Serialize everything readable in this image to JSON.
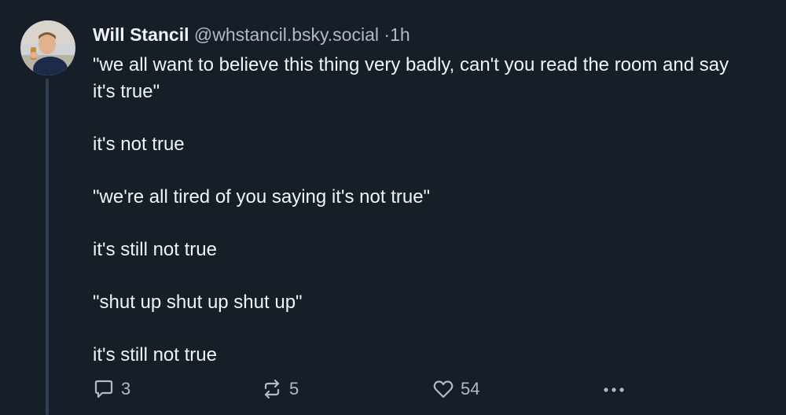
{
  "post": {
    "author": {
      "display_name": "Will Stancil",
      "handle": "@whstancil.bsky.social",
      "separator": "·",
      "timestamp": "1h"
    },
    "body": [
      "\"we all want to believe this thing very badly, can't you read the room and say it's true\"",
      "it's not true",
      "\"we're all tired of you saying it's not true\"",
      "it's still not true",
      "\"shut up shut up shut up\"",
      "it's still not true"
    ],
    "actions": {
      "reply_count": "3",
      "repost_count": "5",
      "like_count": "54"
    },
    "icons": {
      "reply": "reply-icon",
      "repost": "repost-icon",
      "like": "heart-icon",
      "more": "more-options-icon"
    }
  }
}
